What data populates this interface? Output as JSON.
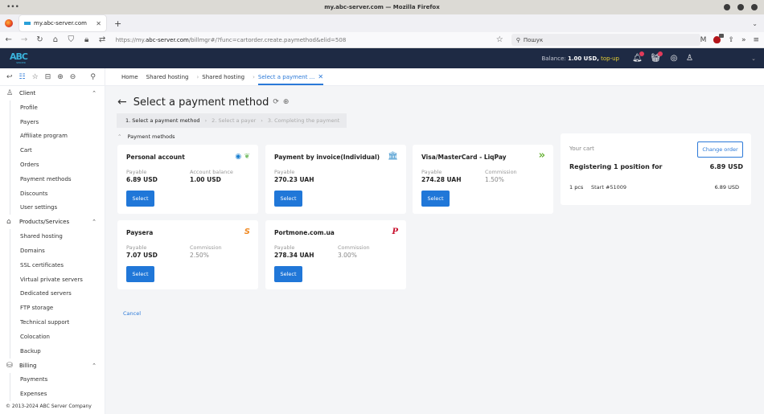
{
  "browser": {
    "window_title": "my.abc-server.com — Mozilla Firefox",
    "tab_title": "my.abc-server.com",
    "url_prefix": "https://my.",
    "url_domain": "abc-server.com",
    "url_path": "/billmgr#/?func=cartorder.create.paymethod&elid=508",
    "search_placeholder": "Пошук"
  },
  "header": {
    "logo_text": "ABC",
    "logo_sub": "SERVER",
    "balance_label": "Balance:",
    "balance_value": "1.00 USD,",
    "topup_label": "top-up",
    "notifications_count": "1",
    "cart_count": "1"
  },
  "breadcrumbs": [
    {
      "label": "Home"
    },
    {
      "label": "Shared hosting"
    },
    {
      "label": "Shared hosting"
    },
    {
      "label": "Select a payment ..."
    }
  ],
  "sidebar": {
    "groups": [
      {
        "label": "Client",
        "icon": "user-icon",
        "items": [
          "Profile",
          "Payers",
          "Affiliate program",
          "Cart",
          "Orders",
          "Payment methods",
          "Discounts",
          "User settings"
        ]
      },
      {
        "label": "Products/Services",
        "icon": "basket-icon",
        "items": [
          "Shared hosting",
          "Domains",
          "SSL certificates",
          "Virtual private servers",
          "Dedicated servers",
          "FTP storage",
          "Technical support",
          "Colocation",
          "Backup"
        ]
      },
      {
        "label": "Billing",
        "icon": "wallet-icon",
        "items": [
          "Payments",
          "Expenses"
        ]
      }
    ],
    "footer": "© 2013-2024 ABC Server Company"
  },
  "page": {
    "title": "Select a payment method",
    "steps": [
      "1. Select a payment method",
      "2. Select a payer",
      "3. Completing the payment"
    ],
    "section_title": "Payment methods",
    "cancel_label": "Cancel",
    "select_label": "Select"
  },
  "methods": [
    {
      "name": "Personal account",
      "payable_label": "Payable",
      "payable": "6.89 USD",
      "second_label": "Account balance",
      "second": "1.00 USD"
    },
    {
      "name": "Payment by invoice(Individual)",
      "payable_label": "Payable",
      "payable": "270.23 UAH"
    },
    {
      "name": "Visa/MasterCard - LiqPay",
      "payable_label": "Payable",
      "payable": "274.28 UAH",
      "second_label": "Commission",
      "second": "1.50%"
    },
    {
      "name": "Paysera",
      "payable_label": "Payable",
      "payable": "7.07 USD",
      "second_label": "Commission",
      "second": "2.50%"
    },
    {
      "name": "Portmone.com.ua",
      "payable_label": "Payable",
      "payable": "278.34 UAH",
      "second_label": "Commission",
      "second": "3.00%"
    }
  ],
  "cart": {
    "title": "Your cart",
    "change_label": "Change order",
    "summary": "Registering 1 position for",
    "total": "6.89 USD",
    "item_qty": "1 pcs",
    "item_name": "Start #51009",
    "item_price": "6.89 USD"
  }
}
